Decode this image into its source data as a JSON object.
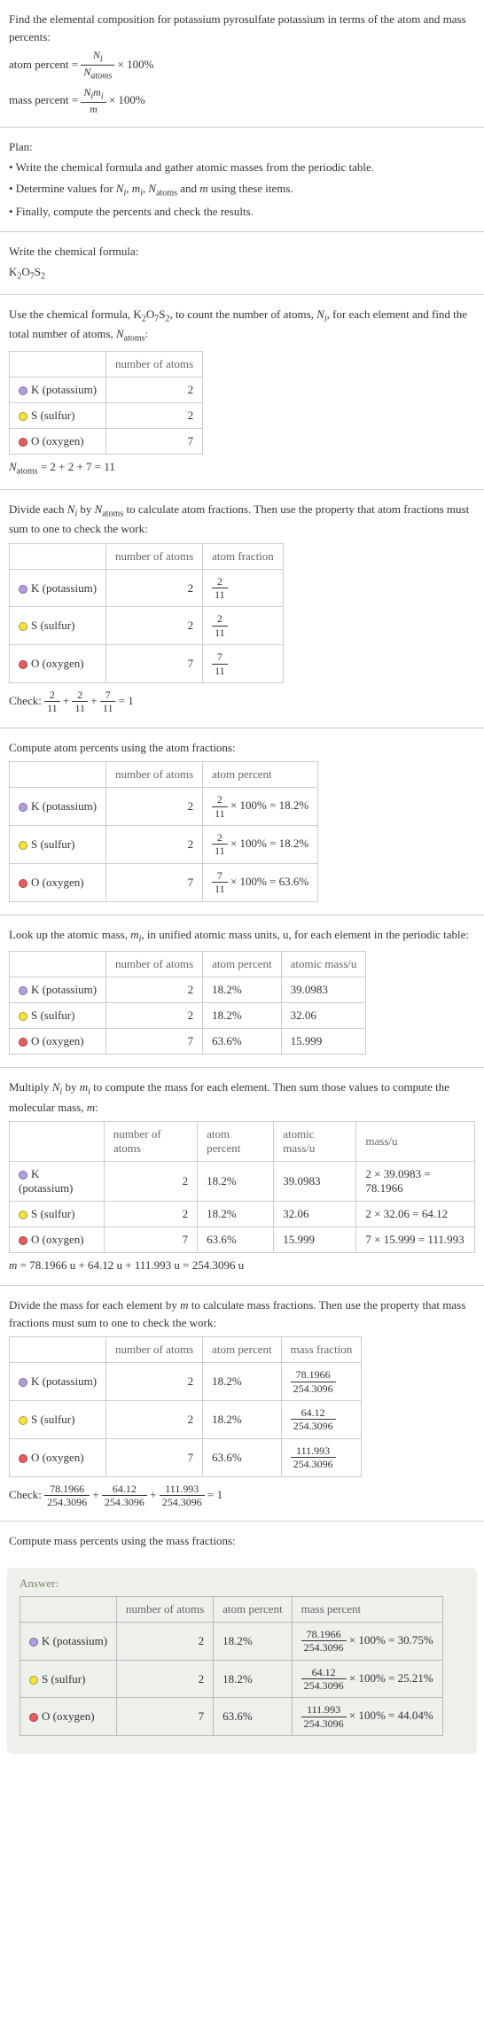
{
  "intro": {
    "prompt": "Find the elemental composition for potassium pyrosulfate potassium in terms of the atom and mass percents:",
    "atom_percent_label": "atom percent = ",
    "atom_percent_frac_num": "N_i",
    "atom_percent_frac_den": "N_atoms",
    "times100": " × 100%",
    "mass_percent_label": "mass percent = ",
    "mass_percent_frac_num": "N_i m_i",
    "mass_percent_frac_den": "m"
  },
  "plan": {
    "heading": "Plan:",
    "b1": "• Write the chemical formula and gather atomic masses from the periodic table.",
    "b2": "• Determine values for N_i, m_i, N_atoms and m using these items.",
    "b3": "• Finally, compute the percents and check the results."
  },
  "formula_section": {
    "heading": "Write the chemical formula:",
    "formula": "K_2O_7S_2"
  },
  "count_section": {
    "text": "Use the chemical formula, K_2O_7S_2, to count the number of atoms, N_i, for each element and find the total number of atoms, N_atoms:",
    "h_atoms": "number of atoms",
    "k_label": "K (potassium)",
    "k_n": "2",
    "s_label": "S (sulfur)",
    "s_n": "2",
    "o_label": "O (oxygen)",
    "o_n": "7",
    "sum": "N_atoms = 2 + 2 + 7 = 11"
  },
  "atomfrac_section": {
    "text": "Divide each N_i by N_atoms to calculate atom fractions. Then use the property that atom fractions must sum to one to check the work:",
    "h_atoms": "number of atoms",
    "h_frac": "atom fraction",
    "k_n": "2",
    "k_f_num": "2",
    "k_f_den": "11",
    "s_n": "2",
    "s_f_num": "2",
    "s_f_den": "11",
    "o_n": "7",
    "o_f_num": "7",
    "o_f_den": "11",
    "check_label": "Check: ",
    "check_eq": " = 1"
  },
  "atompct_section": {
    "text": "Compute atom percents using the atom fractions:",
    "h_atoms": "number of atoms",
    "h_pct": "atom percent",
    "k_n": "2",
    "k_pct": " × 100% = 18.2%",
    "s_n": "2",
    "s_pct": " × 100% = 18.2%",
    "o_n": "7",
    "o_pct": " × 100% = 63.6%"
  },
  "mass_section": {
    "text": "Look up the atomic mass, m_i, in unified atomic mass units, u, for each element in the periodic table:",
    "h_atoms": "number of atoms",
    "h_pct": "atom percent",
    "h_mass": "atomic mass/u",
    "k_n": "2",
    "k_p": "18.2%",
    "k_m": "39.0983",
    "s_n": "2",
    "s_p": "18.2%",
    "s_m": "32.06",
    "o_n": "7",
    "o_p": "63.6%",
    "o_m": "15.999"
  },
  "massmult_section": {
    "text": "Multiply N_i by m_i to compute the mass for each element. Then sum those values to compute the molecular mass, m:",
    "h_atoms": "number of atoms",
    "h_pct": "atom percent",
    "h_mass": "atomic mass/u",
    "h_mu": "mass/u",
    "k_n": "2",
    "k_p": "18.2%",
    "k_m": "39.0983",
    "k_mu": "2 × 39.0983 = 78.1966",
    "s_n": "2",
    "s_p": "18.2%",
    "s_m": "32.06",
    "s_mu": "2 × 32.06 = 64.12",
    "o_n": "7",
    "o_p": "63.6%",
    "o_m": "15.999",
    "o_mu": "7 × 15.999 = 111.993",
    "sum": "m = 78.1966 u + 64.12 u + 111.993 u = 254.3096 u"
  },
  "massfrac_section": {
    "text": "Divide the mass for each element by m to calculate mass fractions. Then use the property that mass fractions must sum to one to check the work:",
    "h_atoms": "number of atoms",
    "h_pct": "atom percent",
    "h_mf": "mass fraction",
    "k_n": "2",
    "k_p": "18.2%",
    "k_mf_num": "78.1966",
    "k_mf_den": "254.3096",
    "s_n": "2",
    "s_p": "18.2%",
    "s_mf_num": "64.12",
    "s_mf_den": "254.3096",
    "o_n": "7",
    "o_p": "63.6%",
    "o_mf_num": "111.993",
    "o_mf_den": "254.3096",
    "check_label": "Check: ",
    "check_eq": " = 1"
  },
  "masspct_section": {
    "text": "Compute mass percents using the mass fractions:"
  },
  "answer": {
    "label": "Answer:",
    "h_atoms": "number of atoms",
    "h_pct": "atom percent",
    "h_mp": "mass percent",
    "k_n": "2",
    "k_p": "18.2%",
    "k_mp_num": "78.1966",
    "k_mp_den": "254.3096",
    "k_mp_tail": " × 100% = 30.75%",
    "s_n": "2",
    "s_p": "18.2%",
    "s_mp_num": "64.12",
    "s_mp_den": "254.3096",
    "s_mp_tail": " × 100% = 25.21%",
    "o_n": "7",
    "o_p": "63.6%",
    "o_mp_num": "111.993",
    "o_mp_den": "254.3096",
    "o_mp_tail": " × 100% = 44.04%"
  },
  "labels": {
    "k": "K (potassium)",
    "s": "S (sulfur)",
    "o": "O (oxygen)"
  }
}
